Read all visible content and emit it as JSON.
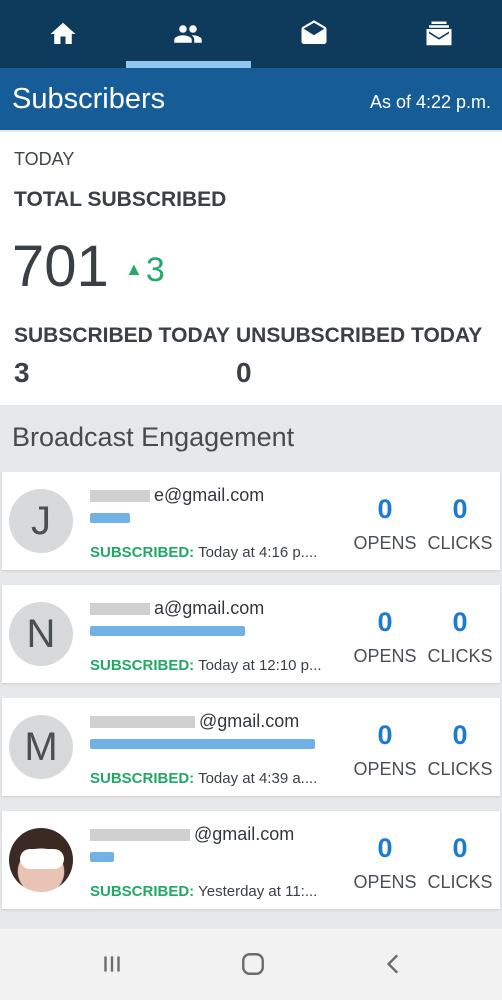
{
  "nav": {
    "tabs": [
      {
        "icon": "home-icon",
        "active": false
      },
      {
        "icon": "users-icon",
        "active": true
      },
      {
        "icon": "open-envelope-icon",
        "active": false
      },
      {
        "icon": "mailbox-icon",
        "active": false
      }
    ]
  },
  "header": {
    "title": "Subscribers",
    "as_of": "As of 4:22 p.m."
  },
  "stats": {
    "period": "TODAY",
    "total_label": "TOTAL SUBSCRIBED",
    "total": "701",
    "delta": "3",
    "subscribed_today_label": "SUBSCRIBED TODAY",
    "subscribed_today": "3",
    "unsubscribed_today_label": "UNSUBSCRIBED TODAY",
    "unsubscribed_today": "0"
  },
  "engagement": {
    "title": "Broadcast Engagement",
    "subscribed_label": "SUBSCRIBED:",
    "opens_label": "OPENS",
    "clicks_label": "CLICKS",
    "items": [
      {
        "initial": "J",
        "email": "e@gmail.com",
        "time": "Today at 4:16 p....",
        "opens": "0",
        "clicks": "0"
      },
      {
        "initial": "N",
        "email": "a@gmail.com",
        "time": "Today at 12:10 p...",
        "opens": "0",
        "clicks": "0"
      },
      {
        "initial": "M",
        "email": "@gmail.com",
        "time": "Today at 4:39 a....",
        "opens": "0",
        "clicks": "0"
      },
      {
        "initial": "",
        "email": "@gmail.com",
        "time": "Yesterday at 11:...",
        "opens": "0",
        "clicks": "0"
      }
    ]
  },
  "colors": {
    "nav_bg": "#0e3a5c",
    "header_bg": "#165d97",
    "accent_green": "#25a96a",
    "metric_blue": "#1c7bd0"
  },
  "system_nav": {
    "buttons": [
      "recents-icon",
      "home-button-icon",
      "back-icon"
    ]
  }
}
